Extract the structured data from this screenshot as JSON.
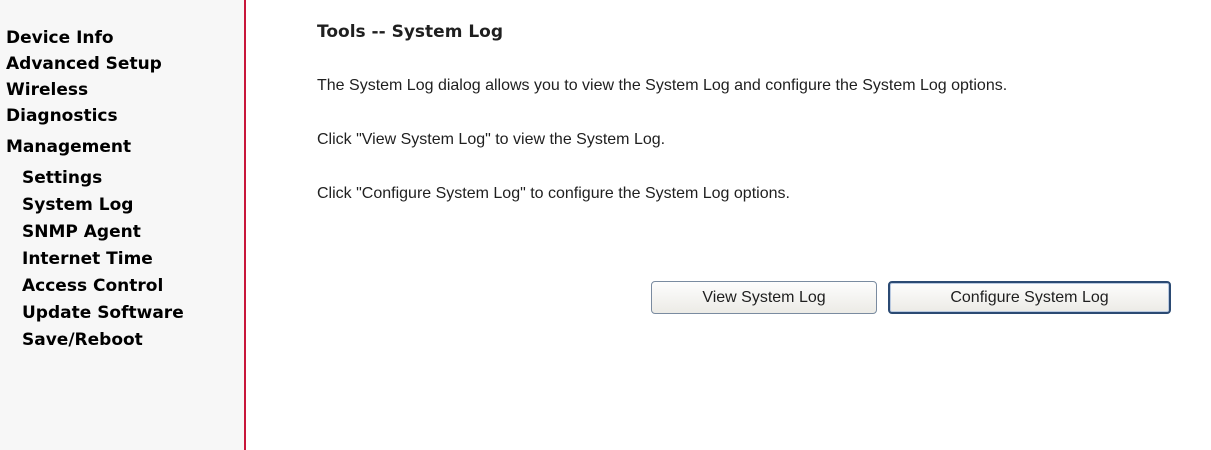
{
  "sidebar": {
    "items": [
      {
        "label": "Device Info",
        "level": "top"
      },
      {
        "label": "Advanced Setup",
        "level": "top"
      },
      {
        "label": "Wireless",
        "level": "top"
      },
      {
        "label": "Diagnostics",
        "level": "top"
      },
      {
        "label": "Management",
        "level": "top"
      },
      {
        "label": "Settings",
        "level": "sub"
      },
      {
        "label": "System Log",
        "level": "sub"
      },
      {
        "label": "SNMP Agent",
        "level": "sub"
      },
      {
        "label": "Internet Time",
        "level": "sub"
      },
      {
        "label": "Access Control",
        "level": "sub"
      },
      {
        "label": "Update Software",
        "level": "sub"
      },
      {
        "label": "Save/Reboot",
        "level": "sub"
      }
    ]
  },
  "main": {
    "title": "Tools -- System Log",
    "description": "The System Log dialog allows you to view the System Log and configure the System Log options.",
    "view_hint": "Click \"View System Log\" to view the System Log.",
    "configure_hint": "Click \"Configure System Log\" to configure the System Log options.",
    "buttons": {
      "view_label": "View System Log",
      "configure_label": "Configure System Log"
    }
  },
  "colors": {
    "sidebar_divider": "#c8163a",
    "button_border": "#7a8ba0",
    "focused_button_border": "#2b4a73"
  }
}
